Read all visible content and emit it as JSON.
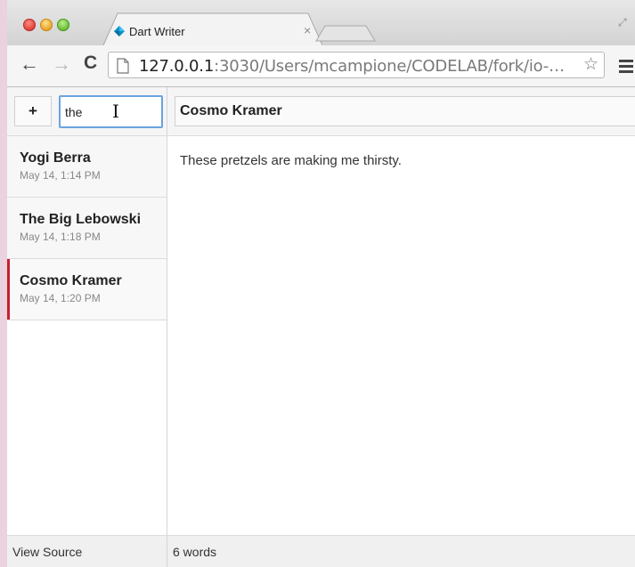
{
  "browser": {
    "tab_title": "Dart Writer",
    "tab_close": "×",
    "url_host": "127.0.0.1",
    "url_rest": ":3030/Users/mcampione/CODELAB/fork/io-…",
    "nav": {
      "back": "←",
      "forward": "→",
      "reload": "C"
    },
    "star": "☆"
  },
  "sidebar": {
    "add_label": "+",
    "search_value": "the",
    "items": [
      {
        "title": "Yogi Berra",
        "date": "May 14, 1:14 PM"
      },
      {
        "title": "The Big Lebowski",
        "date": "May 14, 1:18 PM"
      },
      {
        "title": "Cosmo Kramer",
        "date": "May 14, 1:20 PM",
        "selected": true
      }
    ]
  },
  "editor": {
    "title_value": "Cosmo Kramer",
    "body": "These pretzels are making me thirsty."
  },
  "footer": {
    "view_source": "View Source",
    "word_count": "6 words"
  },
  "colors": {
    "selected_accent": "#c81f2b",
    "focus_border": "#6aa4e0",
    "page_bg": "#ecd1de"
  }
}
